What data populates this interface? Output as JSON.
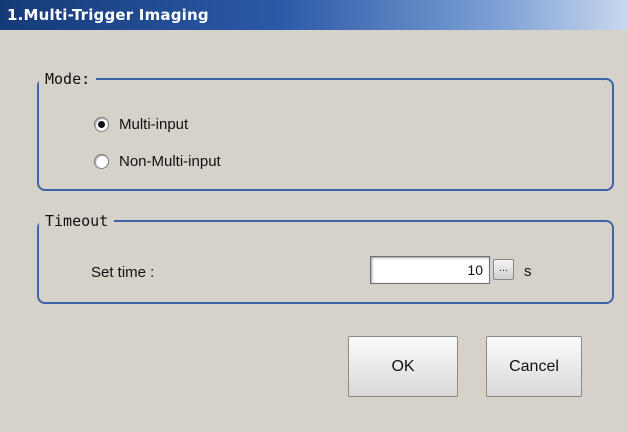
{
  "window": {
    "title": "1.Multi-Trigger Imaging"
  },
  "mode_group": {
    "legend": "Mode:",
    "options": [
      {
        "label": "Multi-input",
        "selected": true
      },
      {
        "label": "Non-Multi-input",
        "selected": false
      }
    ]
  },
  "timeout_group": {
    "legend": "Timeout",
    "set_time_label": "Set time :",
    "set_time_value": "10",
    "ellipsis_label": "...",
    "unit": "s"
  },
  "buttons": {
    "ok": "OK",
    "cancel": "Cancel"
  },
  "colors": {
    "titlebar": "#163a78",
    "group_border": "#3d63a8",
    "background": "#d6d2ca"
  }
}
